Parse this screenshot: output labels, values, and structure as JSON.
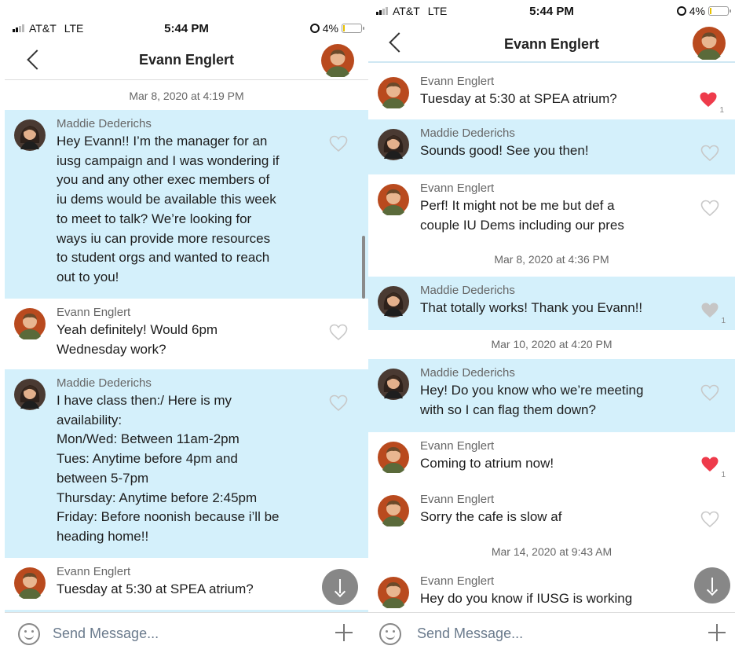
{
  "colors": {
    "accent_blue_row": "#d4f0fb",
    "heart_red": "#ee3b4b",
    "heart_gray": "#c6c6c6"
  },
  "left": {
    "status": {
      "carrier": "AT&T",
      "network": "LTE",
      "time": "5:44 PM",
      "battery": "4%"
    },
    "header": {
      "title": "Evann Englert"
    },
    "feed": {
      "date": "Mar 8, 2020 at 4:19 PM",
      "messages": [
        {
          "author": "Maddie Dederichs",
          "text": "Hey Evann!! I’m the manager for an\niusg campaign and I was wondering if\nyou and any other exec members of\niu dems would be available this week\nto meet to talk? We’re looking for\nways iu can provide more resources\nto student orgs and wanted to reach\nout to you!",
          "liked": false
        },
        {
          "author": "Evann Englert",
          "text": "Yeah definitely! Would 6pm\nWednesday work?",
          "liked": false
        },
        {
          "author": "Maddie Dederichs",
          "text": "I have class then:/ Here is my\navailability:\nMon/Wed: Between 11am-2pm\nTues: Anytime before 4pm and\nbetween 5-7pm\nThursday: Anytime before 2:45pm\nFriday: Before noonish because i’ll be\nheading home!!",
          "liked": false
        },
        {
          "author": "Evann Englert",
          "text": "Tuesday at 5:30 at SPEA atrium?",
          "liked": false
        }
      ]
    },
    "compose": {
      "placeholder": "Send Message..."
    }
  },
  "right": {
    "status": {
      "carrier": "AT&T",
      "network": "LTE",
      "time": "5:44 PM",
      "battery": "4%"
    },
    "header": {
      "title": "Evann Englert"
    },
    "feed": {
      "msg1": {
        "author": "Evann Englert",
        "text": "Tuesday at 5:30 at SPEA atrium?",
        "likes": "1"
      },
      "msg2": {
        "author": "Maddie Dederichs",
        "text": "Sounds good! See you then!"
      },
      "msg3": {
        "author": "Evann Englert",
        "text": "Perf! It might not be me but def a\ncouple IU Dems including our pres"
      },
      "date1": "Mar 8, 2020 at 4:36 PM",
      "msg4": {
        "author": "Maddie Dederichs",
        "text": "That totally works! Thank you Evann!!",
        "likes": "1"
      },
      "date2": "Mar 10, 2020 at 4:20 PM",
      "msg5": {
        "author": "Maddie Dederichs",
        "text": "Hey! Do you know who we’re meeting\nwith so I can flag them down?"
      },
      "msg6": {
        "author": "Evann Englert",
        "text": "Coming to atrium now!",
        "likes": "1"
      },
      "msg7": {
        "author": "Evann Englert",
        "text": "Sorry the cafe is slow af"
      },
      "date3": "Mar 14, 2020 at 9:43 AM",
      "msg8": {
        "author": "Evann Englert",
        "text": "Hey do you know if IUSG is working"
      }
    },
    "compose": {
      "placeholder": "Send Message..."
    }
  }
}
